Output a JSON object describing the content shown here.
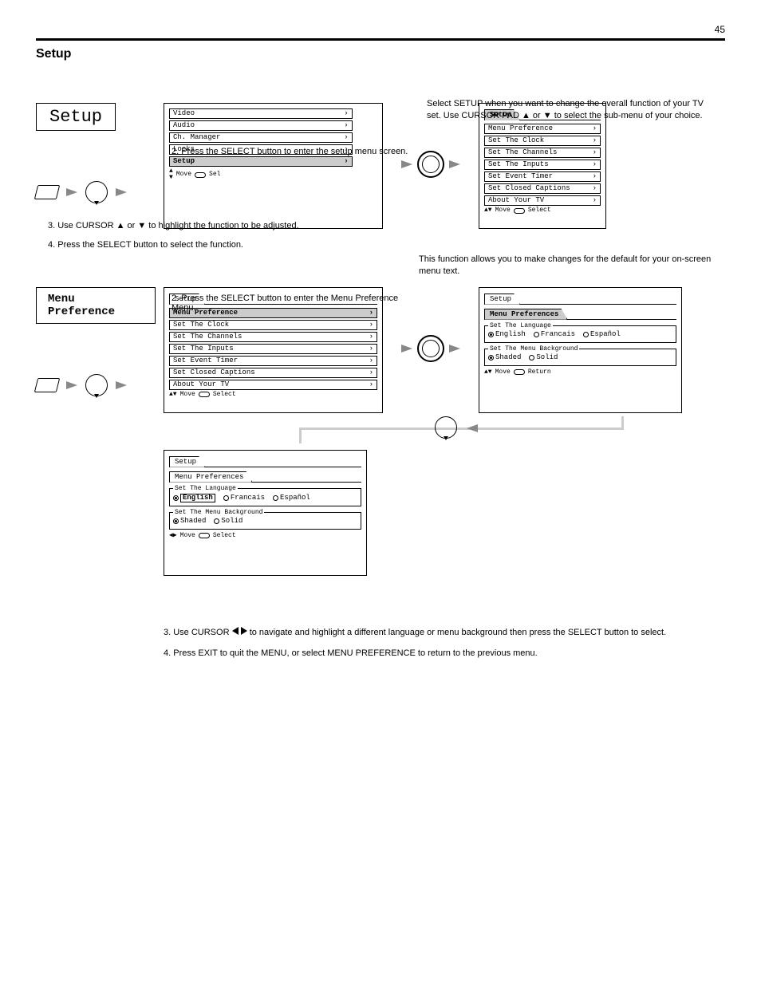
{
  "page_number": "45",
  "page_title": "Setup",
  "section1": {
    "label": "Setup",
    "step1": "Select SETUP when you want to change the overall function of your TV set. Use CURSOR PAD ▲ or ▼ to select the sub-menu of your choice.",
    "step2": "2. Press the SELECT button to enter the setup menu screen."
  },
  "osd_main": {
    "items": [
      "Video",
      "Audio",
      "Ch. Manager",
      "Locks",
      "Setup"
    ],
    "highlight": "Setup",
    "hint_move": "Move",
    "hint_sel": "Sel"
  },
  "osd_setup": {
    "tab": "Setup",
    "items": [
      "Menu Preference",
      "Set The Clock",
      "Set The Channels",
      "Set The Inputs",
      "Set Event Timer",
      "Set Closed Captions",
      "About Your TV"
    ],
    "hint_move": "Move",
    "hint_sel": "Select"
  },
  "section2_mid": {
    "text_a": "3. Use CURSOR ▲ or ▼ to highlight the function to be adjusted.",
    "text_b": "4. Press the SELECT button to select the function."
  },
  "section2": {
    "label": "Menu Preference",
    "step1": "This function allows you to make changes for the default for your on-screen menu text.",
    "step2": "2. Press the SELECT button to enter the Menu Preference Menu.",
    "step3_a": "3. Use CURSOR ",
    "step3_b": " to navigate and highlight a different language or menu background then press the SELECT button to select.",
    "step4": "4. Press EXIT to quit the MENU, or select MENU PREFERENCE to return to the previous menu."
  },
  "osd_setup_hl": {
    "tab": "Setup",
    "items": [
      "Menu Preference",
      "Set The Clock",
      "Set The Channels",
      "Set The Inputs",
      "Set Event Timer",
      "Set Closed Captions",
      "About Your TV"
    ],
    "highlight": "Menu Preference",
    "hint_move": "Move",
    "hint_sel": "Select"
  },
  "osd_pref": {
    "crumb1": "Setup",
    "crumb2": "Menu Preferences",
    "lang_legend": "Set The Language",
    "langs": [
      "English",
      "Francais",
      "Español"
    ],
    "bg_legend": "Set The Menu Background",
    "bgs": [
      "Shaded",
      "Solid"
    ],
    "hint_move": "Move",
    "hint_ret": "Return"
  },
  "osd_pref2": {
    "crumb1": "Setup",
    "crumb2": "Menu Preferences",
    "lang_legend": "Set The Language",
    "langs": [
      "English",
      "Francais",
      "Español"
    ],
    "highlight_lang": "English",
    "bg_legend": "Set The Menu Background",
    "bgs": [
      "Shaded",
      "Solid"
    ],
    "hint_move": "Move",
    "hint_sel": "Select"
  }
}
